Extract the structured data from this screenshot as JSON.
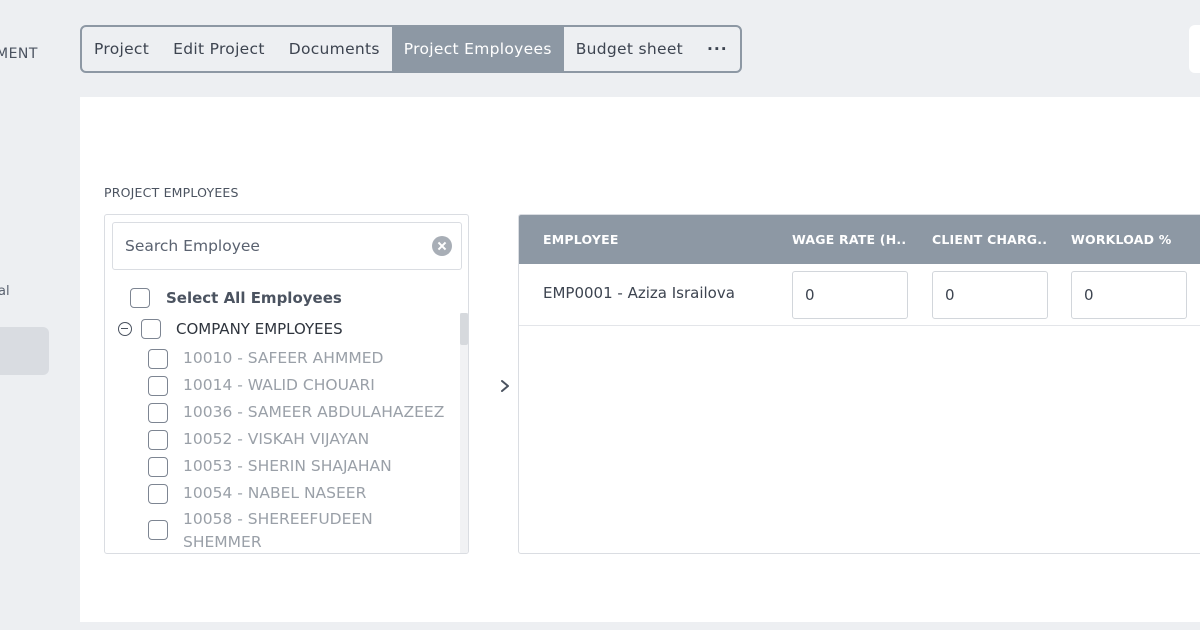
{
  "sidebar": {
    "heading": "MENT",
    "item_partial": "al"
  },
  "tabs": [
    {
      "label": "Project",
      "active": false
    },
    {
      "label": "Edit Project",
      "active": false
    },
    {
      "label": "Documents",
      "active": false
    },
    {
      "label": "Project Employees",
      "active": true
    },
    {
      "label": "Budget sheet",
      "active": false
    },
    {
      "label": "···",
      "active": false
    }
  ],
  "section": {
    "title": "PROJECT EMPLOYEES"
  },
  "tree": {
    "search_placeholder": "Search Employee",
    "select_all_label": "Select All Employees",
    "group_label": "COMPANY EMPLOYEES",
    "employees": [
      "10010 - SAFEER AHMMED",
      "10014 - WALID CHOUARI",
      "10036 - SAMEER ABDULAHAZEEZ",
      "10052 - VISKAH VIJAYAN",
      "10053 - SHERIN SHAJAHAN",
      "10054 - NABEL NASEER",
      "10058 - SHEREEFUDEEN",
      "SHEMMER"
    ]
  },
  "table": {
    "headers": [
      "EMPLOYEE",
      "WAGE RATE (H...",
      "CLIENT CHARG...",
      "WORKLOAD %"
    ],
    "rows": [
      {
        "employee": "EMP0001 - Aziza Israilova",
        "wage_rate": "0",
        "client_charge": "0",
        "workload": "0"
      }
    ]
  },
  "colors": {
    "accent": "#8d98a4",
    "background": "#edeff2",
    "panel": "#ffffff"
  }
}
